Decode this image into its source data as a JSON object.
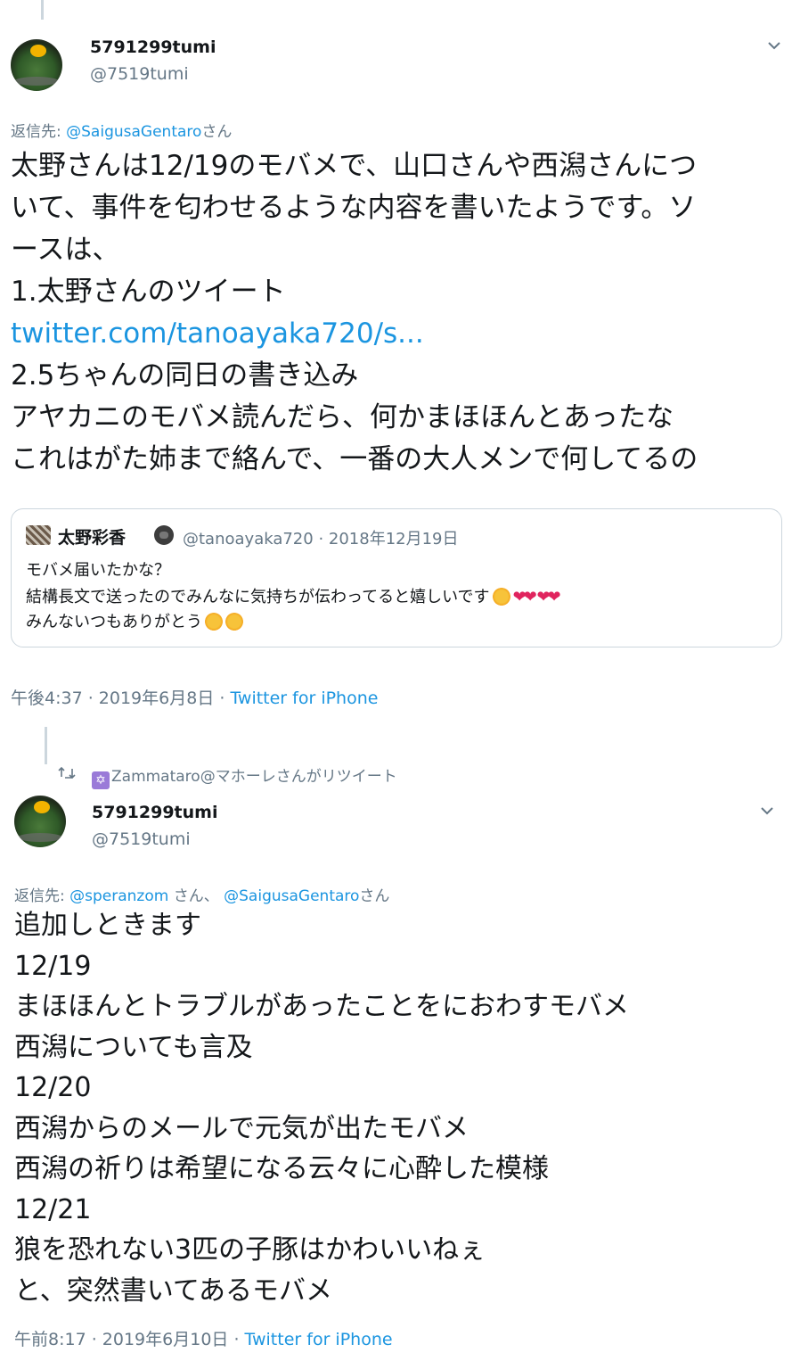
{
  "tweet1": {
    "display_name": "5791299tumi",
    "handle": "@7519tumi",
    "reply_prefix": "返信先: ",
    "reply_mention": "@SaigusaGentaro",
    "reply_suffix": "さん",
    "body_lines": [
      "太野さんは12/19のモバメで、山口さんや西潟さんにつ",
      "いて、事件を匂わせるような内容を書いたようです。ソ",
      "ースは、",
      "1.太野さんのツイート"
    ],
    "link": "twitter.com/tanoayaka720/s...",
    "body_lines_after": [
      "2.5ちゃんの同日の書き込み",
      "アヤカニのモバメ読んだら、何かまほほんとあったな",
      "これはがた姉まで絡んで、一番の大人メンで何してるの"
    ],
    "quote": {
      "name": "太野彩香",
      "meta": "@tanoayaka720 · 2018年12月19日",
      "line1": "モバメ届いたかな？",
      "line2": "結構長文で送ったのでみんなに気持ちが伝わってると嬉しいです",
      "line3": "みんないつもありがとう"
    },
    "time": "午後4:37 · 2019年6月8日 · ",
    "via": "Twitter for iPhone"
  },
  "tweet2": {
    "retweeted_by": "Zammataro@マホーレさんがリツイート",
    "display_name": "5791299tumi",
    "handle": "@7519tumi",
    "reply_prefix": "返信先: ",
    "reply_mention1": "@speranzom",
    "reply_mid": " さん、 ",
    "reply_mention2": "@SaigusaGentaro",
    "reply_suffix": "さん",
    "body_lines": [
      "追加しときます",
      "12/19",
      "まほほんとトラブルがあったことをにおわすモバメ",
      "西潟についても言及",
      "12/20",
      "西潟からのメールで元気が出たモバメ",
      "西潟の祈りは希望になる云々に心酔した模様",
      "12/21",
      "狼を恐れない3匹の子豚はかわいいねぇ",
      "と、突然書いてあるモバメ"
    ],
    "time": "午前8:17 · 2019年6月10日 · ",
    "via": "Twitter for iPhone"
  },
  "colors": {
    "link": "#1b95e0",
    "muted": "#657786",
    "text": "#14171a",
    "border": "#ccd6dd"
  }
}
